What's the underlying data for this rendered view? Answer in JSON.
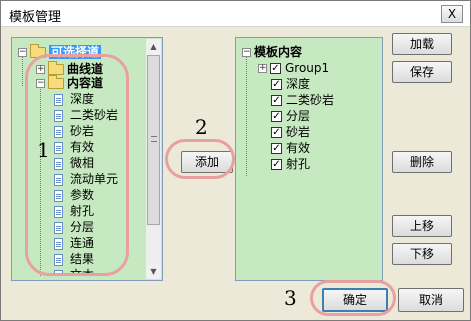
{
  "window": {
    "title": "模板管理",
    "close_glyph": "X"
  },
  "left_tree": {
    "root": {
      "label": "可选择道",
      "expander": "−"
    },
    "children": [
      {
        "label": "曲线道",
        "expander": "+"
      },
      {
        "label": "内容道",
        "expander": "−"
      }
    ],
    "items": [
      "深度",
      "二类砂岩",
      "砂岩",
      "有效",
      "微相",
      "流动单元",
      "参数",
      "射孔",
      "分层",
      "连通",
      "结果",
      "文本"
    ]
  },
  "right_tree": {
    "root": {
      "label": "模板内容",
      "expander": "−"
    },
    "group": {
      "label": "Group1",
      "expander": "+"
    },
    "items": [
      "深度",
      "二类砂岩",
      "分层",
      "砂岩",
      "有效",
      "射孔"
    ],
    "check_glyph": "✓"
  },
  "scrollbar": {
    "up": "▲",
    "down": "▼"
  },
  "buttons": {
    "add": "添加",
    "load": "加载",
    "save": "保存",
    "delete": "删除",
    "move_up": "上移",
    "move_down": "下移",
    "ok": "确定",
    "cancel": "取消"
  },
  "annotations": {
    "n1": "1",
    "n2": "2",
    "n3": "3"
  }
}
